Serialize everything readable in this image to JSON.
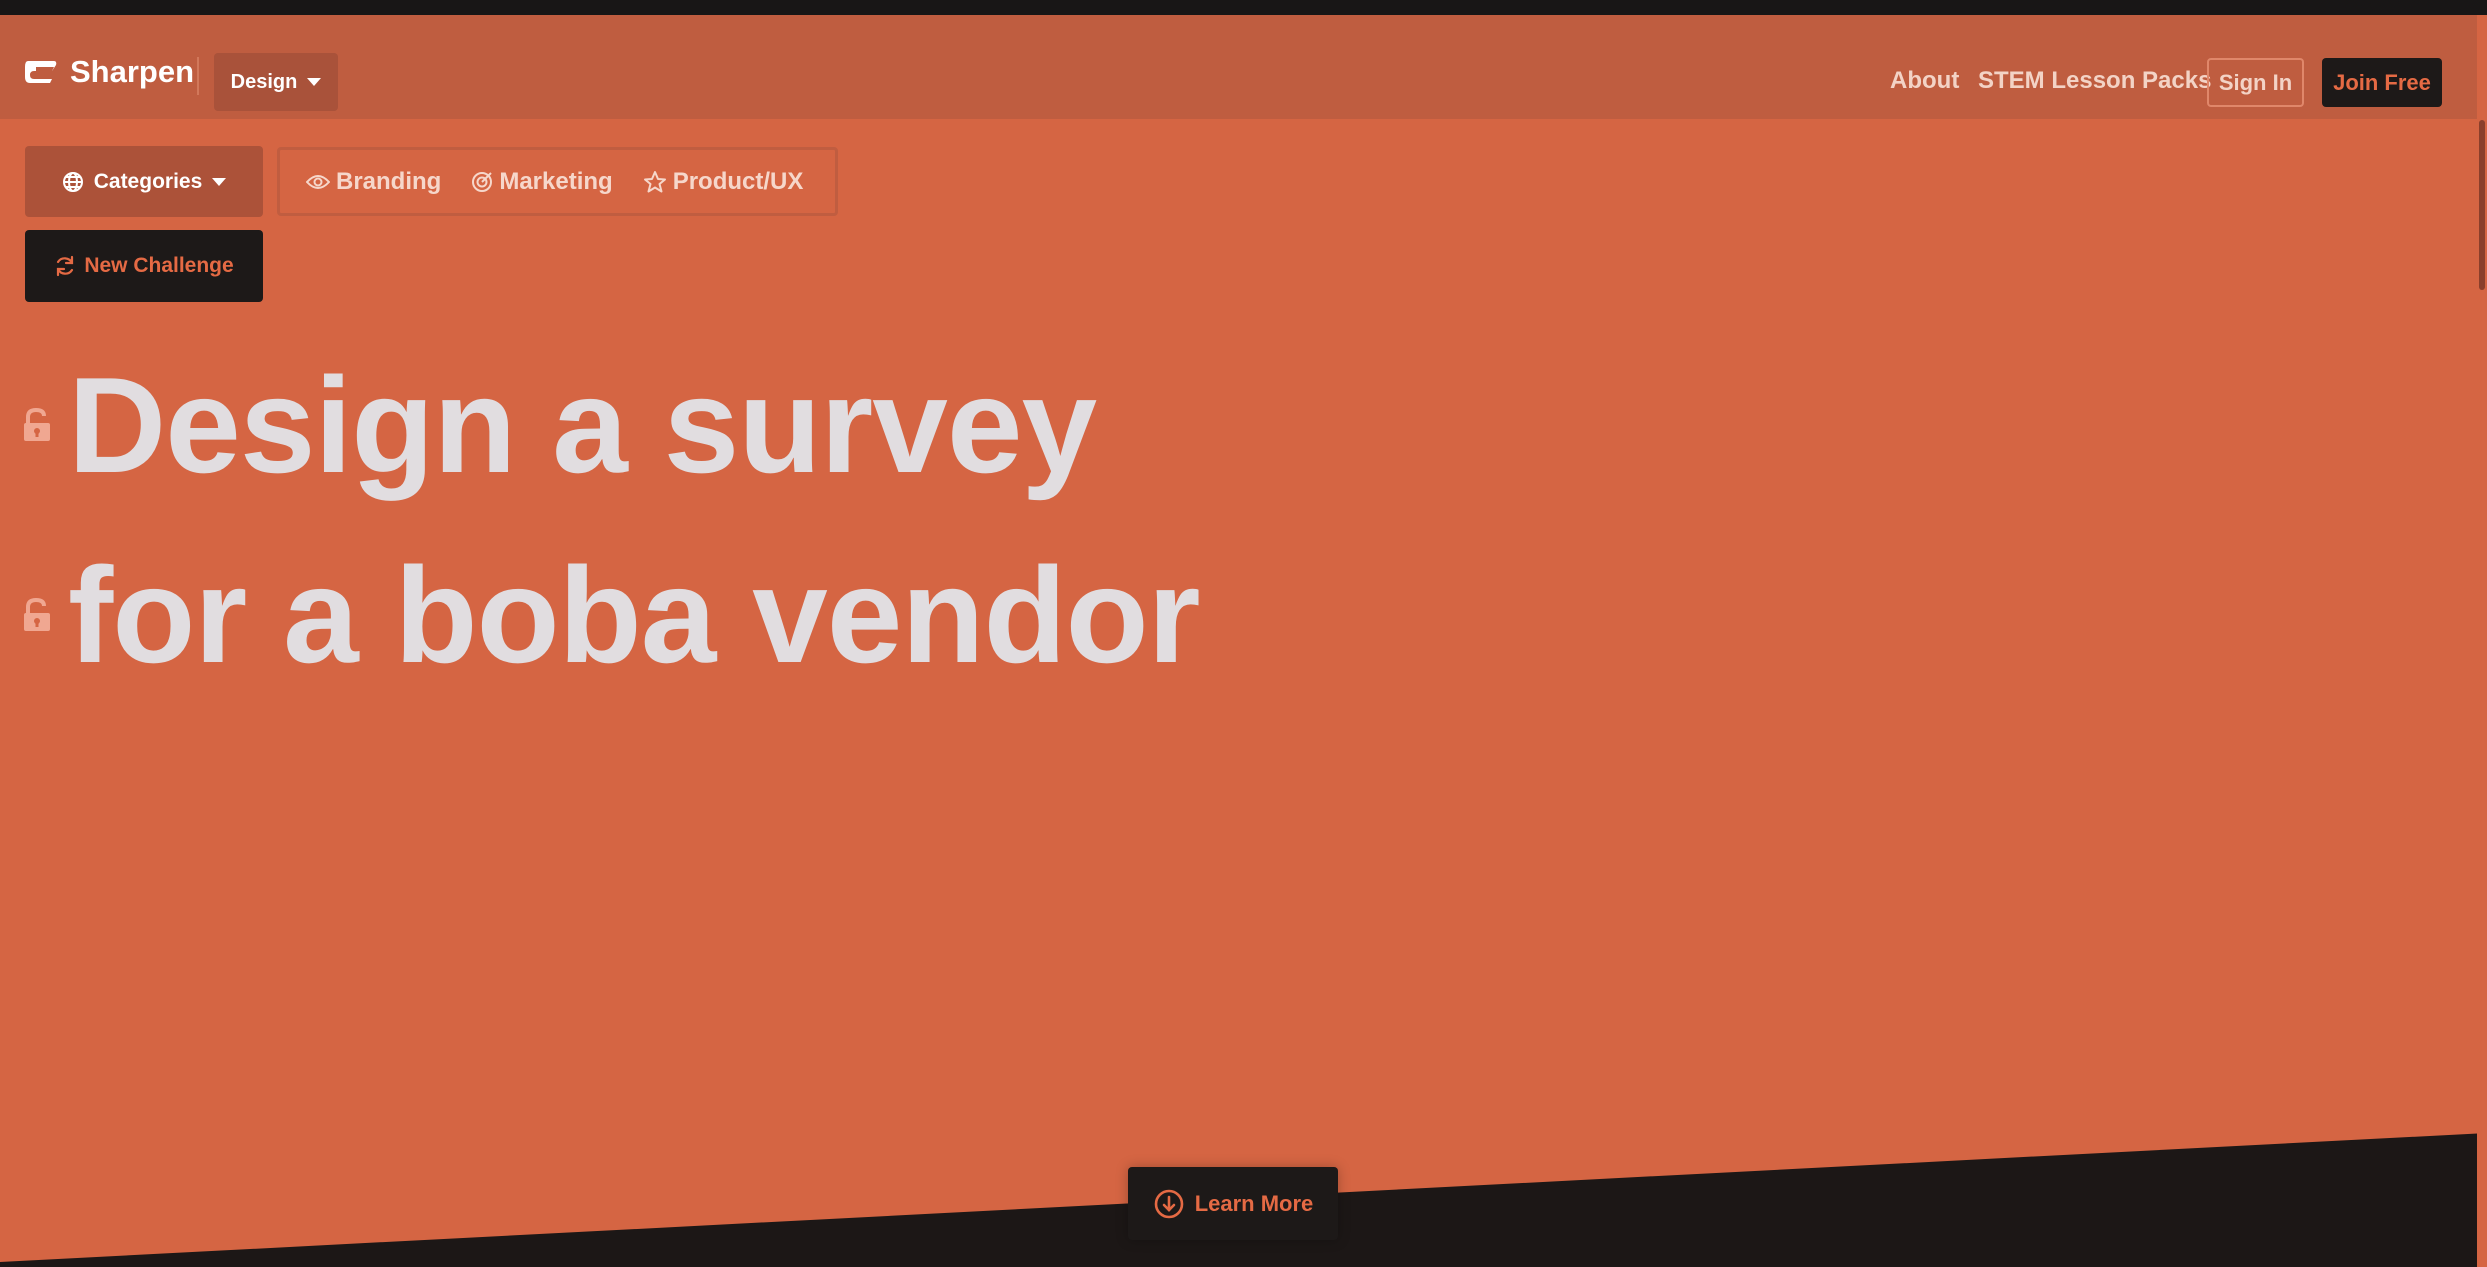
{
  "brand": {
    "name": "Sharpen"
  },
  "header": {
    "category_dropdown": "Design",
    "nav": {
      "about": "About",
      "stem": "STEM Lesson Packs"
    },
    "sign_in": "Sign In",
    "join": "Join Free"
  },
  "controls": {
    "categories_label": "Categories",
    "category_items": [
      {
        "label": "Branding",
        "icon": "eye-icon"
      },
      {
        "label": "Marketing",
        "icon": "target-icon"
      },
      {
        "label": "Product/UX",
        "icon": "star-icon"
      }
    ],
    "new_challenge": "New Challenge"
  },
  "challenge": {
    "line1": "Design a survey",
    "line2": "for a boba vendor"
  },
  "footer": {
    "learn_more": "Learn More"
  },
  "colors": {
    "background": "#d56543",
    "header": "#bf5d40",
    "dark": "#1d1918",
    "accent_text": "#e56a44",
    "headline": "#e1dde0"
  }
}
